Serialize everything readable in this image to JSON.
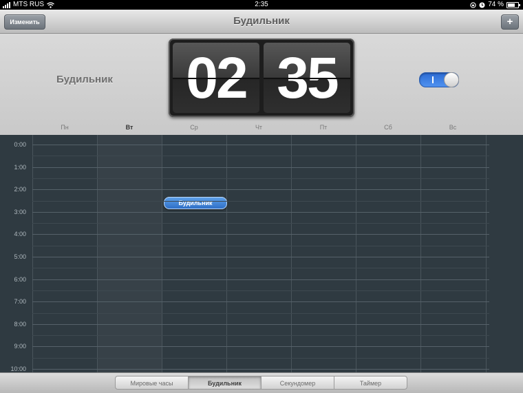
{
  "status_bar": {
    "carrier": "MTS RUS",
    "time": "2:35",
    "battery_text": "74 %",
    "battery_level": 0.74,
    "icons": [
      "signal-icon",
      "wifi-icon",
      "lock-rotation-icon",
      "alarm-clock-icon",
      "battery-icon"
    ]
  },
  "nav": {
    "title": "Будильник",
    "edit_label": "Изменить",
    "add_label": "+"
  },
  "header": {
    "label": "Будильник",
    "hours": "02",
    "minutes": "35",
    "toggle_on": true,
    "toggle_mark": "I",
    "accent_color": "#3a7fe0"
  },
  "days": [
    {
      "label": "Пн",
      "active": false
    },
    {
      "label": "Вт",
      "active": true
    },
    {
      "label": "Ср",
      "active": false
    },
    {
      "label": "Чт",
      "active": false
    },
    {
      "label": "Пт",
      "active": false
    },
    {
      "label": "Сб",
      "active": false
    },
    {
      "label": "Вс",
      "active": false
    }
  ],
  "hours": [
    "0:00",
    "1:00",
    "2:00",
    "3:00",
    "4:00",
    "5:00",
    "6:00",
    "7:00",
    "8:00",
    "9:00",
    "10:00"
  ],
  "event": {
    "label": "Будильник",
    "day": "Ср",
    "time": "2:35"
  },
  "tabs": [
    {
      "label": "Мировые часы",
      "active": false
    },
    {
      "label": "Будильник",
      "active": true
    },
    {
      "label": "Секундомер",
      "active": false
    },
    {
      "label": "Таймер",
      "active": false
    }
  ]
}
